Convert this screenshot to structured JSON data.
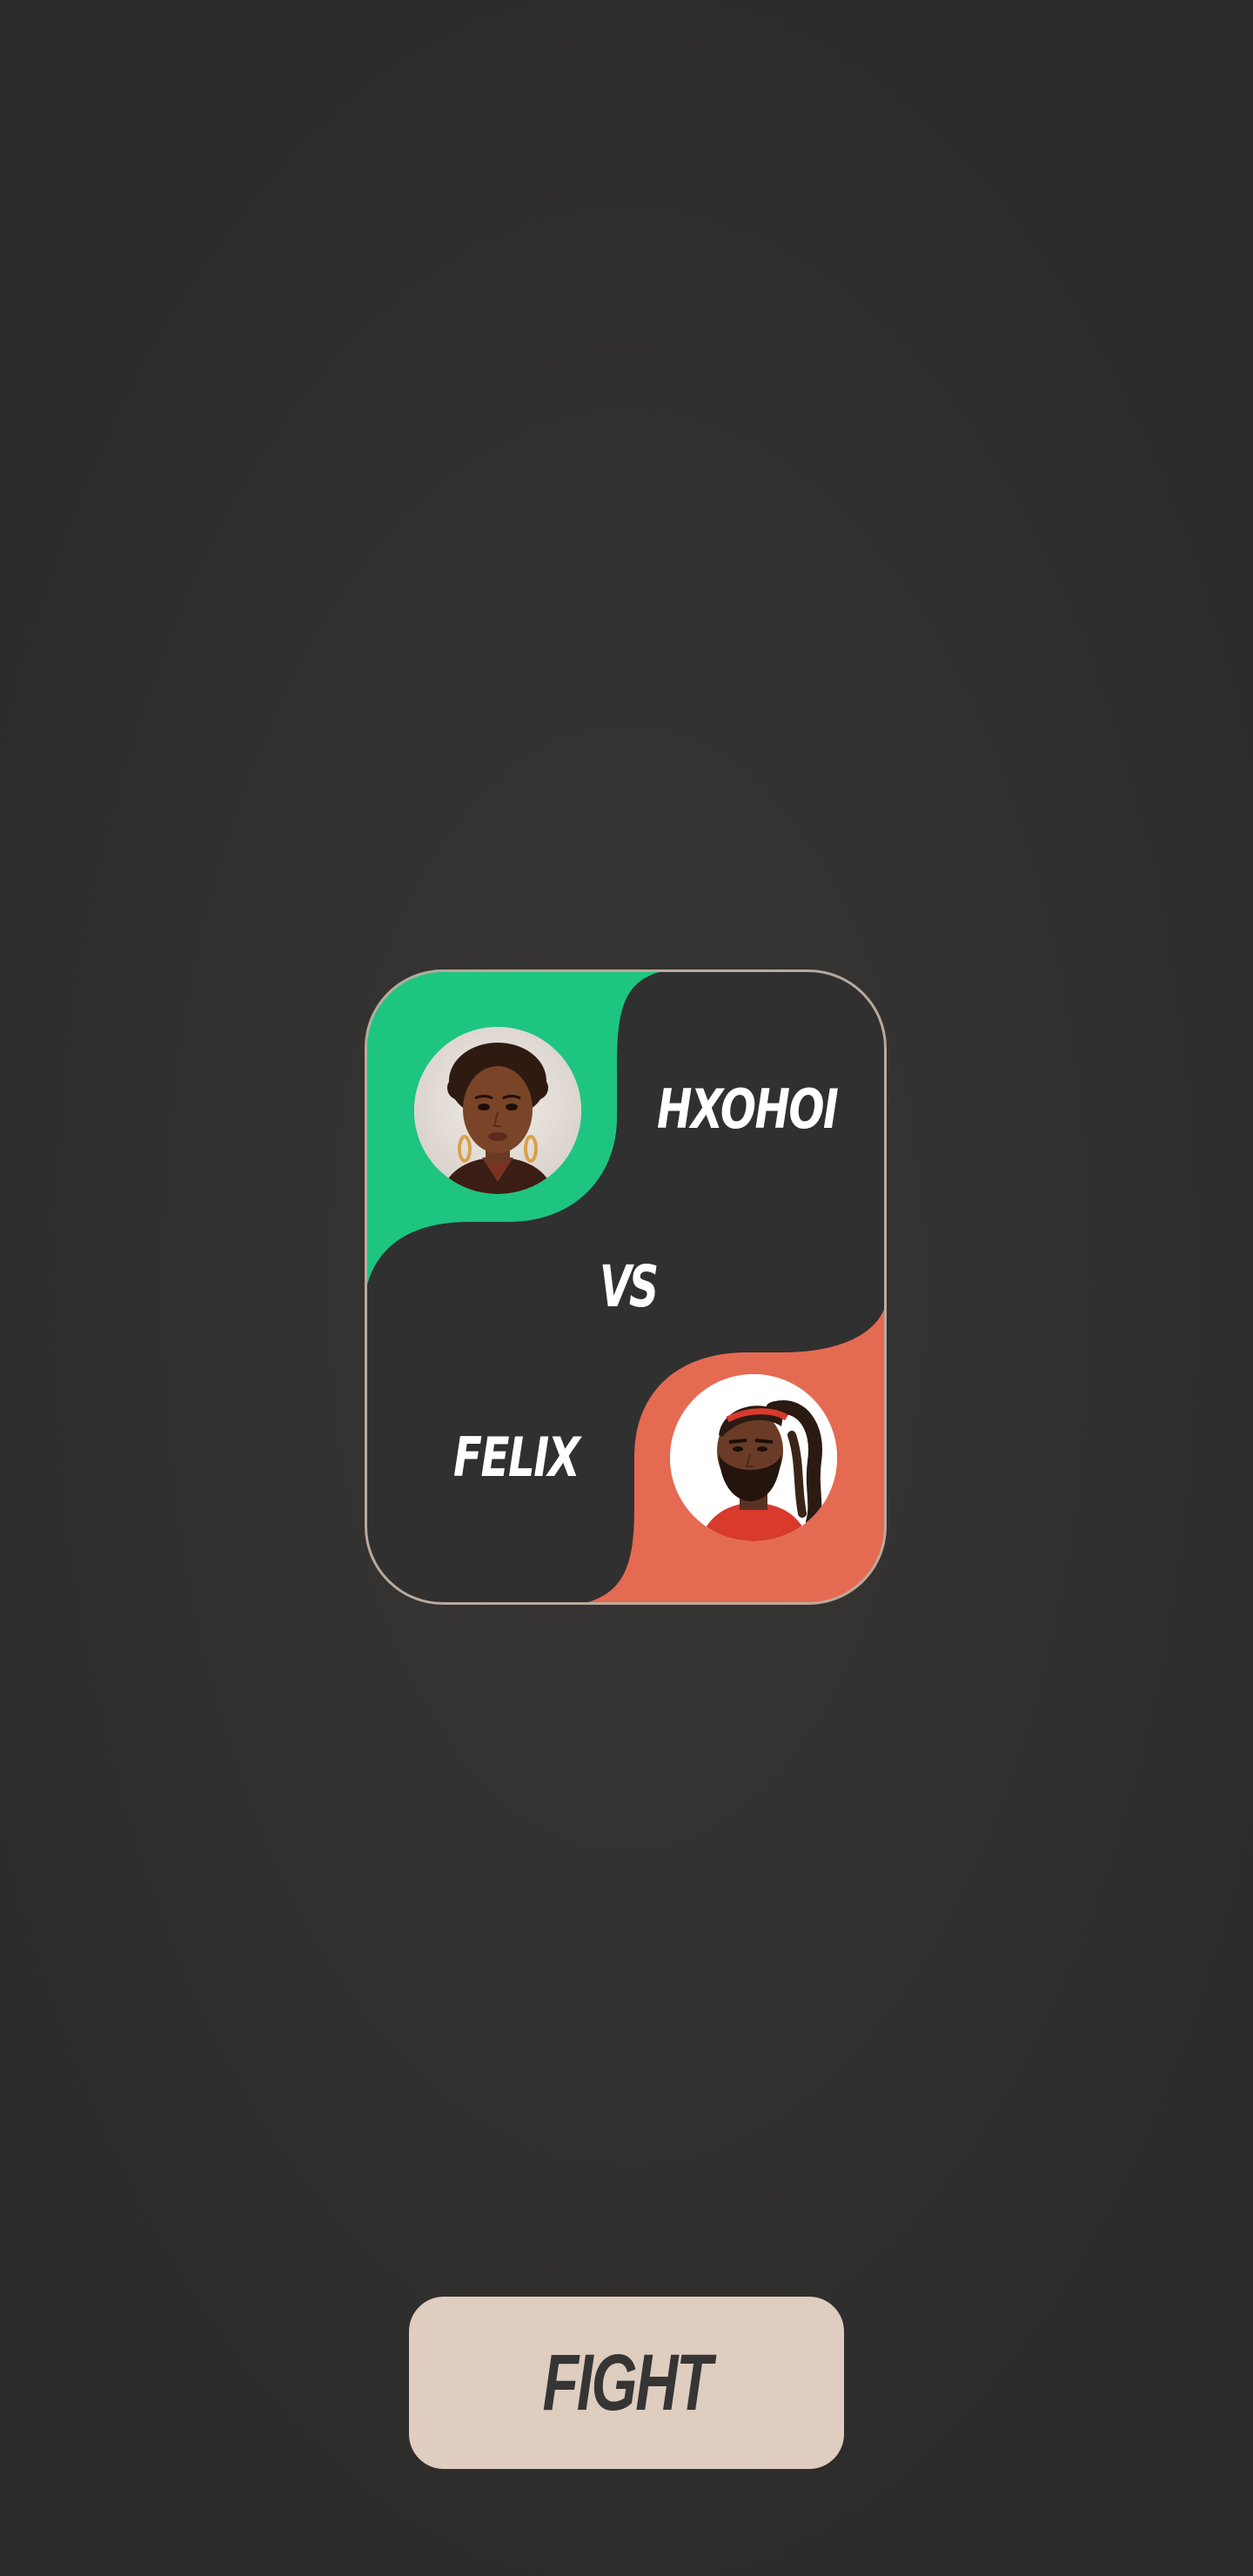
{
  "match": {
    "player_one": {
      "name": "HXOHOI",
      "accent_color": "#1ec580"
    },
    "player_two": {
      "name": "FELIX",
      "accent_color": "#e56a52"
    },
    "versus_label": "VS"
  },
  "actions": {
    "fight_label": "FIGHT"
  },
  "theme": {
    "background": "#333231",
    "card_border": "#b8aa9d",
    "button_background": "#dfcdbf",
    "button_text": "#363535"
  },
  "icons": {
    "player_one_avatar": "woman-portrait-avatar",
    "player_two_avatar": "bearded-man-portrait-avatar"
  }
}
